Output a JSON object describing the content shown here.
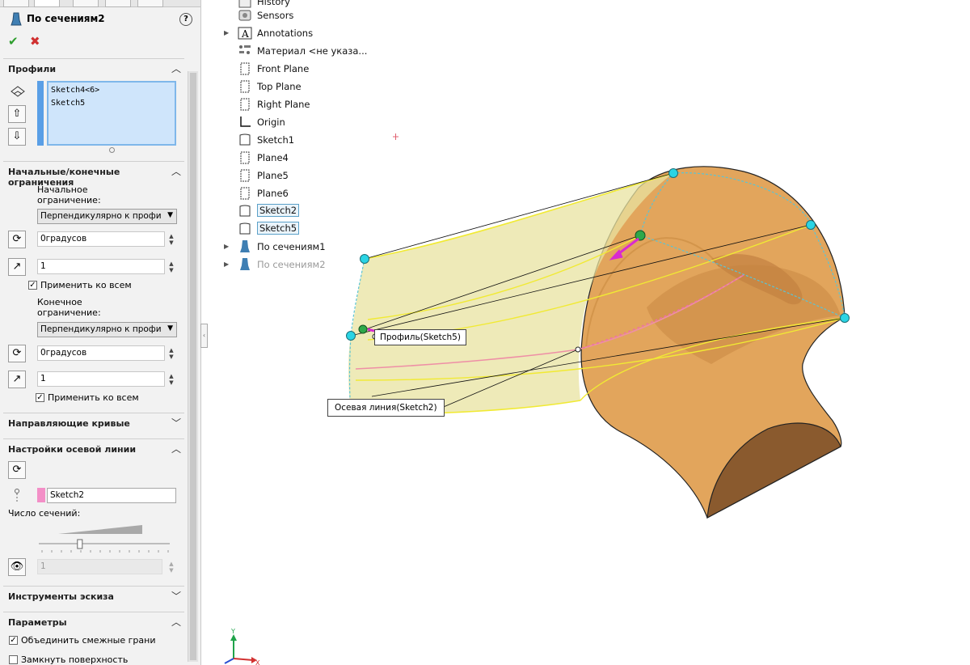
{
  "property_manager": {
    "feature_title": "По сечениям2",
    "help_icon": "help-icon",
    "ok_icon": "check-icon",
    "cancel_icon": "cancel-icon",
    "profiles": {
      "header": "Профили",
      "items": [
        "Sketch4<6>",
        "Sketch5"
      ]
    },
    "constraints": {
      "header": "Начальные/конечные ограничения",
      "start_label_1": "Начальное",
      "start_label_2": "ограничение:",
      "start_select": "Перпендикулярно к профи",
      "start_angle": "0градусов",
      "start_length": "1",
      "start_apply_all": "Применить ко всем",
      "end_label_1": "Конечное",
      "end_label_2": "ограничение:",
      "end_select": "Перпендикулярно к профи",
      "end_angle": "0градусов",
      "end_length": "1",
      "end_apply_all": "Применить ко всем"
    },
    "guide_curves": {
      "header": "Направляющие кривые"
    },
    "centerline": {
      "header": "Настройки осевой линии",
      "sketch": "Sketch2",
      "sections_label": "Число сечений:",
      "sections_value": "1",
      "slider_fraction": 0.3
    },
    "sketch_tools": {
      "header": "Инструменты эскиза"
    },
    "options": {
      "header": "Параметры",
      "merge_tangent": "Объединить смежные грани",
      "close_loft": "Замкнуть поверхность",
      "merge_tangent_checked": true,
      "close_loft_checked": false
    }
  },
  "feature_tree": {
    "items": [
      {
        "label": "History",
        "icon": "history-icon"
      },
      {
        "label": "Sensors",
        "icon": "sensors-icon"
      },
      {
        "label": "Annotations",
        "icon": "annotations-icon"
      },
      {
        "label": "Материал <не указа...",
        "icon": "material-icon"
      },
      {
        "label": "Front Plane",
        "icon": "plane-icon"
      },
      {
        "label": "Top Plane",
        "icon": "plane-icon"
      },
      {
        "label": "Right Plane",
        "icon": "plane-icon"
      },
      {
        "label": "Origin",
        "icon": "origin-icon"
      },
      {
        "label": "Sketch1",
        "icon": "sketch-icon"
      },
      {
        "label": "Plane4",
        "icon": "plane-icon"
      },
      {
        "label": "Plane5",
        "icon": "plane-icon"
      },
      {
        "label": "Plane6",
        "icon": "plane-icon"
      },
      {
        "label": "Sketch2",
        "icon": "sketch-icon"
      },
      {
        "label": "Sketch5",
        "icon": "sketch-icon"
      },
      {
        "label": "По сечениям1",
        "icon": "loft-icon"
      },
      {
        "label": "По сечениям2",
        "icon": "loft-icon"
      }
    ]
  },
  "viewport": {
    "callout_profile": "Профиль(Sketch5)",
    "callout_centerline": "Осевая линия(Sketch2)",
    "triad_axis_y": "Y",
    "triad_axis_x": "X",
    "colors": {
      "body": "#e0a45a",
      "preview": "#e8e3a0",
      "handle": "#2ad4e4",
      "arrow": "#d92ad0",
      "centerline": "#ee8fa6"
    }
  }
}
